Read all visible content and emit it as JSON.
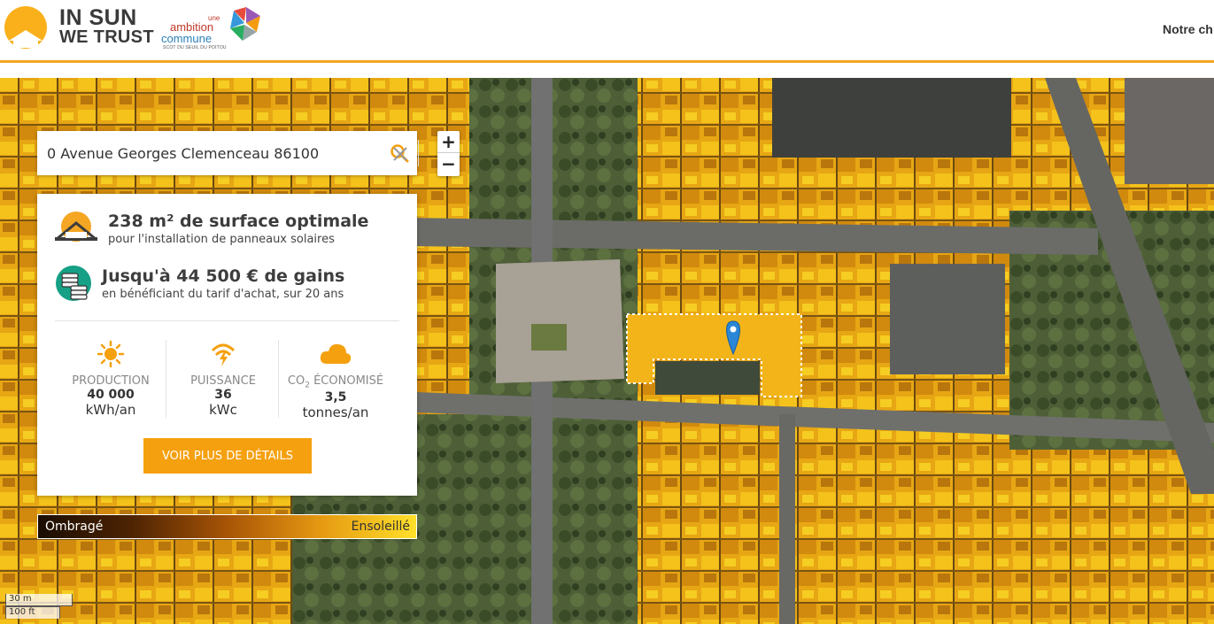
{
  "header": {
    "logo_line1": "IN SUN",
    "logo_line2": "WE TRUST",
    "partner_une": "une",
    "partner_ambition": "ambition",
    "partner_commune": "commune",
    "partner_sub": "SCOT DU SEUIL DU POITOU",
    "nav_link": "Notre ch"
  },
  "search": {
    "value": "0 Avenue Georges Clemenceau 86100",
    "search_icon": "search-icon",
    "clear_icon": "close-icon"
  },
  "zoom": {
    "in_label": "+",
    "out_label": "−"
  },
  "panel": {
    "surface_title": "238 m² de surface optimale",
    "surface_sub": "pour l'installation de panneaux solaires",
    "gains_title": "Jusqu'à 44 500 € de gains",
    "gains_sub": "en bénéficiant du tarif d'achat, sur 20 ans",
    "stats": [
      {
        "label": "PRODUCTION",
        "value": "40 000",
        "unit": "kWh/an",
        "icon": "sun-icon"
      },
      {
        "label": "PUISSANCE",
        "value": "36",
        "unit": "kWc",
        "icon": "power-signal-icon"
      },
      {
        "label_prefix": "CO",
        "label_sub": "2",
        "label_suffix": " ÉCONOMISÉ",
        "value": "3,5",
        "unit": "tonnes/an",
        "icon": "cloud-icon"
      }
    ],
    "details_button": "VOIR PLUS DE DÉTAILS"
  },
  "legend": {
    "left": "Ombragé",
    "right": "Ensoleillé"
  },
  "scale": {
    "metric": "30 m",
    "imperial": "100 ft"
  },
  "colors": {
    "accent": "#f5a00f",
    "header_border": "#f5a623",
    "teal": "#16a085"
  }
}
